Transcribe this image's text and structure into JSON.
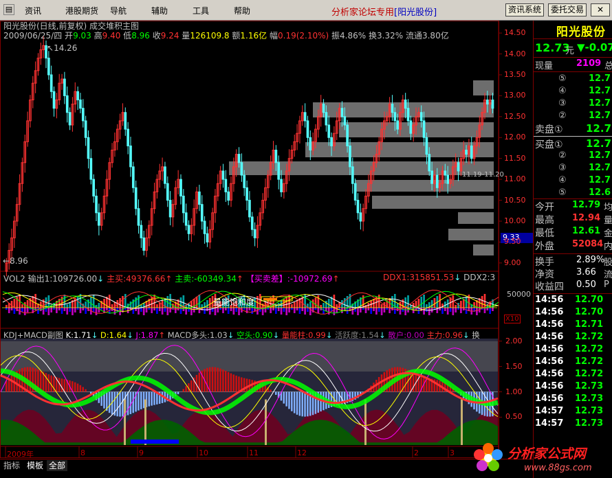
{
  "menu": {
    "items": [
      "资讯",
      "港股期货",
      "导航",
      "辅助",
      "工具",
      "帮助"
    ],
    "title": "分析家论坛专用",
    "stock_tag": "[阳光股份]",
    "btn_info": "资讯系统",
    "btn_order": "委托交易"
  },
  "chart": {
    "title_line": "阳光股份(日线,前复权) 成交堆积主图",
    "date": "2009/06/25/四",
    "open_label": "开",
    "open": "9.03",
    "high_label": "高",
    "high": "9.40",
    "low_label": "低",
    "low": "8.96",
    "close_label": "收",
    "close": "9.24",
    "vol_label": "量",
    "vol": "126109.8",
    "amt_label": "额",
    "amt": "1.16亿",
    "chg_label": "幅",
    "chg": "0.19(2.10%)",
    "amp_label": "振",
    "amp": "4.86%",
    "turn_label": "换",
    "turn": "3.32%",
    "float_label": "流通",
    "float": "3.80亿",
    "y_ticks": [
      "14.50",
      "14.00",
      "13.50",
      "13.00",
      "12.50",
      "12.00",
      "11.50",
      "11.00",
      "10.50",
      "10.00",
      "9.50",
      "9.00"
    ],
    "current_price_tag": "9.33",
    "high_annot": "14.26",
    "low_annot": "8.96",
    "zone_annot": "11.19-11.20",
    "colors": {
      "up": "#ff3232",
      "down": "#54fcfc",
      "box": "#808080"
    }
  },
  "vol_panel": {
    "label": "VOL2",
    "out1": "输出1:109726.00",
    "main_buy": "主买:49376.66",
    "main_sell": "主卖:-60349.34",
    "diff": "【买卖差】:-10972.69",
    "ddx1": "DDX1:315851.53",
    "ddx2": "DDX2:3",
    "annot": "量能饱和度",
    "y_tick": "50000",
    "unit": "X10"
  },
  "kdj_panel": {
    "label": "KDJ+MACD副图",
    "k": "K:1.71",
    "d": "D:1.64",
    "j": "J:1.87",
    "macd_long": "MACD多头:1.03",
    "short": "空头:0.90",
    "energy": "量能柱:0.99",
    "activity": "活跃度:1.54",
    "retail": "散户:0.00",
    "main": "主力:0.96",
    "tail": "换",
    "y_ticks": [
      "2.00",
      "1.50",
      "1.00",
      "0.50"
    ]
  },
  "x_axis": [
    "2009年",
    "8",
    "9",
    "10",
    "11",
    "12",
    "2",
    "3"
  ],
  "quote": {
    "name": "阳光股份",
    "price": "12.73",
    "unit": "元",
    "change": "▼-0.07",
    "current_vol_label": "现量",
    "current_vol": "2109",
    "current_vol_tail": "总",
    "sell_levels": [
      {
        "label": "⑤",
        "price": "12.7"
      },
      {
        "label": "④",
        "price": "12.7"
      },
      {
        "label": "③",
        "price": "12.7"
      },
      {
        "label": "②",
        "price": "12.7"
      }
    ],
    "sell1_label": "卖盘①",
    "sell1_price": "12.7",
    "buy1_label": "买盘①",
    "buy1_price": "12.7",
    "buy_levels": [
      {
        "label": "②",
        "price": "12.7"
      },
      {
        "label": "③",
        "price": "12.7"
      },
      {
        "label": "④",
        "price": "12.7"
      },
      {
        "label": "⑤",
        "price": "12.6"
      }
    ],
    "stats": [
      {
        "label": "今开",
        "value": "12.79",
        "tail": "均",
        "color": "#00ff00"
      },
      {
        "label": "最高",
        "value": "12.94",
        "tail": "量",
        "color": "#ff3232"
      },
      {
        "label": "最低",
        "value": "12.61",
        "tail": "金",
        "color": "#00ff00"
      },
      {
        "label": "外盘",
        "value": "52084",
        "tail": "内",
        "color": "#ff3232"
      }
    ],
    "fund": [
      {
        "label": "换手",
        "value": "2.89%",
        "tail": "股"
      },
      {
        "label": "净资",
        "value": "3.66",
        "tail": "流"
      },
      {
        "label": "收益四",
        "value": "0.50",
        "tail": "P"
      }
    ],
    "ticks": [
      {
        "time": "14:56",
        "price": "12.70"
      },
      {
        "time": "14:56",
        "price": "12.70"
      },
      {
        "time": "14:56",
        "price": "12.71"
      },
      {
        "time": "14:56",
        "price": "12.72"
      },
      {
        "time": "14:56",
        "price": "12.72"
      },
      {
        "time": "14:56",
        "price": "12.72"
      },
      {
        "time": "14:56",
        "price": "12.72"
      },
      {
        "time": "14:56",
        "price": "12.73"
      },
      {
        "time": "14:56",
        "price": "12.73"
      },
      {
        "time": "14:57",
        "price": "12.73"
      },
      {
        "time": "14:57",
        "price": "12.73"
      }
    ]
  },
  "tabs": [
    "指标",
    "模板",
    "全部"
  ],
  "watermark": {
    "text": "分析家公式网",
    "url": "www.88gs.com"
  }
}
